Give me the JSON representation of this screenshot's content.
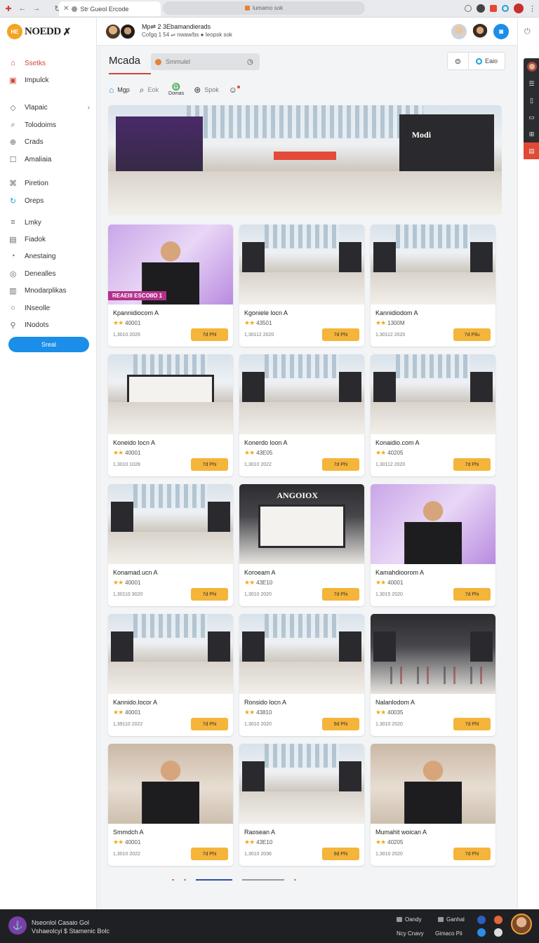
{
  "browser": {
    "tab_title": "Str Gueol Ercode",
    "address": "lumamo sok"
  },
  "logo": {
    "text": "NOEDD",
    "badge": "HE"
  },
  "sidebar": {
    "items": [
      {
        "label": "Ssetks",
        "icon": "home-icon"
      },
      {
        "label": "Impulck",
        "icon": "inbox-icon"
      },
      {
        "label": "Vlapaic",
        "icon": "tag-icon"
      },
      {
        "label": "Tolodoims",
        "icon": "search-icon"
      },
      {
        "label": "Crads",
        "icon": "circle-plus-icon"
      },
      {
        "label": "Amaliaia",
        "icon": "square-icon"
      },
      {
        "label": "Piretion",
        "icon": "link-icon"
      },
      {
        "label": "Oreps",
        "icon": "refresh-icon"
      },
      {
        "label": "Lmky",
        "icon": "list-icon"
      },
      {
        "label": "Fiadok",
        "icon": "document-icon"
      },
      {
        "label": "Anestaing",
        "icon": "clock-icon"
      },
      {
        "label": "Denealles",
        "icon": "compass-icon"
      },
      {
        "label": "Mnodarplikas",
        "icon": "archive-icon"
      },
      {
        "label": "INseolle",
        "icon": "ring-icon"
      },
      {
        "label": "INodots",
        "icon": "user-icon"
      }
    ],
    "button_label": "Sreal"
  },
  "header": {
    "title": "Mp⇌ 2 3Ebamandierads",
    "subtitle": "Cofgq 1 54 ⇌ nwaw/bs ● Ieopsk sok"
  },
  "main": {
    "page_title": "Mcada",
    "search_placeholder": "Smmulel",
    "action_label": "Eaio"
  },
  "filters": [
    {
      "label": "Mgp"
    },
    {
      "label": "Eok"
    },
    {
      "label": "Domas"
    },
    {
      "label": "Spok"
    }
  ],
  "cards": [
    {
      "name": "Kpannidiocom A",
      "rating": "40001",
      "date": "1,3010 2026",
      "price": "7d Phl",
      "scene": "promo"
    },
    {
      "name": "Kgoniele locn A",
      "rating": "43501",
      "date": "1,30112 2020",
      "price": "7d Phi",
      "scene": "mall"
    },
    {
      "name": "Kannidiodom A",
      "rating": "1300M",
      "date": "1,30112 2020",
      "price": "7d Pilu",
      "scene": "mall"
    },
    {
      "name": "Koneido locn A",
      "rating": "40001",
      "date": "1,3010 1028",
      "price": "7d Phi",
      "scene": "store"
    },
    {
      "name": "Konerdo loon A",
      "rating": "43E05",
      "date": "1,3010 2022",
      "price": "7d Phi",
      "scene": "mall"
    },
    {
      "name": "Konaidio.com A",
      "rating": "40205",
      "date": "1,30112 2020",
      "price": "7d Phi",
      "scene": "mall"
    },
    {
      "name": "Konamad.ucn A",
      "rating": "40001",
      "date": "1,30110 3020",
      "price": "7d Phi",
      "scene": "mall"
    },
    {
      "name": "Koroeam A",
      "rating": "43E10",
      "date": "1,3010 2020",
      "price": "7d Phi",
      "scene": "store-dark"
    },
    {
      "name": "Kamahdioorom A",
      "rating": "40001",
      "date": "1,3015 2020",
      "price": "7d Phi",
      "scene": "promo"
    },
    {
      "name": "Kannido.locor A",
      "rating": "40001",
      "date": "1,39110 2022",
      "price": "7d Phi",
      "scene": "mall"
    },
    {
      "name": "Ronsido locn A",
      "rating": "43810",
      "date": "1,3010 2020",
      "price": "9d Phi",
      "scene": "mall"
    },
    {
      "name": "Nalanlodom A",
      "rating": "40035",
      "date": "1,3010 2020",
      "price": "7d Phl",
      "scene": "mall-dark"
    },
    {
      "name": "Smmdch A",
      "rating": "40001",
      "date": "1,3010 2022",
      "price": "7d Phi",
      "scene": "person"
    },
    {
      "name": "Raosean A",
      "rating": "43E10",
      "date": "1,3010 2036",
      "price": "9d Phi",
      "scene": "mall"
    },
    {
      "name": "Mumahit woican A",
      "rating": "40205",
      "date": "1,3010 2020",
      "price": "7d Phi",
      "scene": "person"
    }
  ],
  "promo_tag": "REAEIII ESCOIIO 1",
  "hero_brand": "Modi",
  "store_brand": "ANGOIOX",
  "taskbar": {
    "line1": "Nseonlol Casaio Gol",
    "line2": "Vshaeolcyi $ Stamenic Bolc",
    "items": [
      {
        "label": "Oandy"
      },
      {
        "label": "Ganhal"
      },
      {
        "label": "Ncy Cnavy"
      },
      {
        "label": "Gimaco Pii"
      }
    ]
  }
}
